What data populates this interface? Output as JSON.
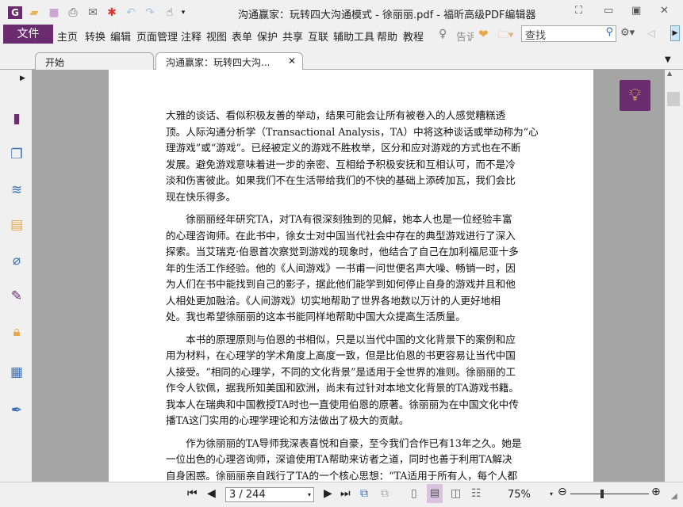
{
  "window": {
    "title": "沟通赢家：玩转四大沟通模式 - 徐丽丽.pdf - 福昕高级PDF编辑器"
  },
  "menu": {
    "file": "文件",
    "items": [
      "主页",
      "转换",
      "编辑",
      "页面管理",
      "注释",
      "视图",
      "表单",
      "保护",
      "共享",
      "互联",
      "辅助工具",
      "帮助",
      "教程"
    ],
    "tell": "告诉",
    "search_placeholder": "查找"
  },
  "tabs": [
    {
      "label": "开始"
    },
    {
      "label": "沟通赢家：玩转四大沟..."
    }
  ],
  "document": {
    "paragraphs": [
      [
        "大雅的谈话、看似积极友善的举动，结果可能会让所有被卷入的人感觉糟糕透",
        "顶。人际沟通分析学（Transactional Analysis，TA）中将这种谈话或举动称为“心",
        "理游戏”或“游戏”。已经被定义的游戏不胜枚举，区分和应对游戏的方式也在不断",
        "发展。避免游戏意味着进一步的亲密、互相给予积极安抚和互相认可，而不是冷",
        "淡和伤害彼此。如果我们不在生活带给我们的不快的基础上添砖加瓦，我们会比",
        "现在快乐得多。"
      ],
      [
        "　　徐丽丽经年研究TA，对TA有很深刻独到的见解，她本人也是一位经验丰富",
        "的心理咨询师。在此书中，徐女士对中国当代社会中存在的典型游戏进行了深入",
        "探索。当艾瑞克·伯恩首次察觉到游戏的现象时，他结合了自己在加利福尼亚十多",
        "年的生活工作经验。他的《人间游戏》一书甫一问世便名声大噪、畅销一时，因",
        "为人们在书中能找到自己的影子，据此他们能学到如何停止自身的游戏并且和他",
        "人相处更加融洽。《人间游戏》切实地帮助了世界各地数以万计的人更好地相",
        "处。我也希望徐丽丽的这本书能同样地帮助中国大众提高生活质量。"
      ],
      [
        "　　本书的原理原则与伯恩的书相似，只是以当代中国的文化背景下的案例和应",
        "用为材料，在心理学的学术角度上高度一致，但是比伯恩的书更容易让当代中国",
        "人接受。“相同的心理学，不同的文化背景”是适用于全世界的准则。徐丽丽的工",
        "作令人钦佩，据我所知美国和欧洲，尚未有过针对本地文化背景的TA游戏书籍。",
        "我本人在瑞典和中国教授TA时也一直使用伯恩的原著。徐丽丽为在中国文化中传",
        "播TA这门实用的心理学理论和方法做出了极大的贡献。"
      ],
      [
        "　　作为徐丽丽的TA导师我深表喜悦和自豪，至今我们合作已有13年之久。她是",
        "一位出色的心理咨询师，深谙使用TA帮助来访者之道，同时也善于利用TA解决",
        "自身困惑。徐丽丽亲自践行了TA的一个核心思想：“TA适用于所有人，每个人都"
      ]
    ]
  },
  "status": {
    "page": "3 / 244",
    "zoom": "75%",
    "zoom_fraction": 0.4
  }
}
